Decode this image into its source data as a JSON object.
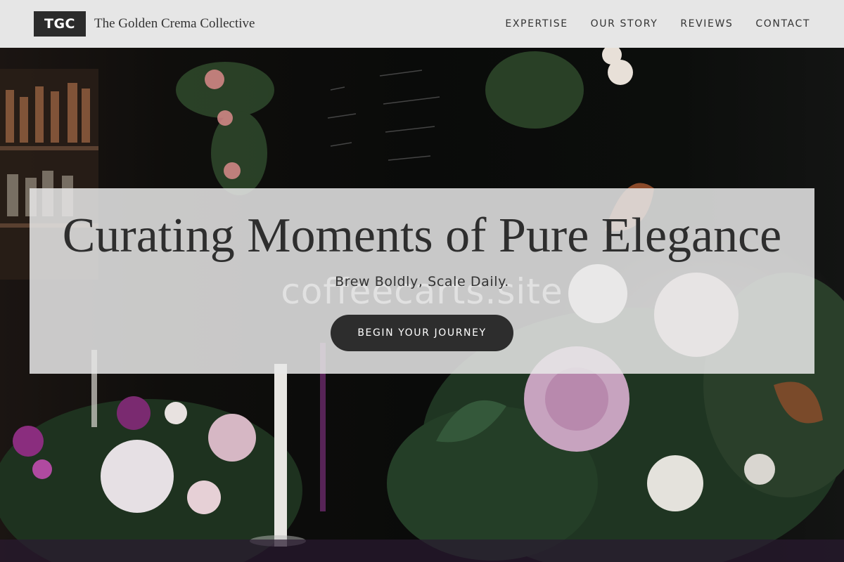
{
  "header": {
    "logo_text": "TGC",
    "brand_name": "The Golden Crema Collective",
    "nav": [
      {
        "label": "EXPERTISE"
      },
      {
        "label": "OUR STORY"
      },
      {
        "label": "REVIEWS"
      },
      {
        "label": "CONTACT"
      }
    ]
  },
  "hero": {
    "headline": "Curating Moments of Pure Elegance",
    "tagline": "Brew Boldly, Scale Daily.",
    "cta_label": "BEGIN YOUR JOURNEY",
    "watermark": "coffeecarts.site"
  },
  "colors": {
    "header_bg": "#e6e6e6",
    "logo_bg": "#2b2b2b",
    "cta_bg": "#2d2d2d",
    "text_dark": "#2e2e2e"
  }
}
